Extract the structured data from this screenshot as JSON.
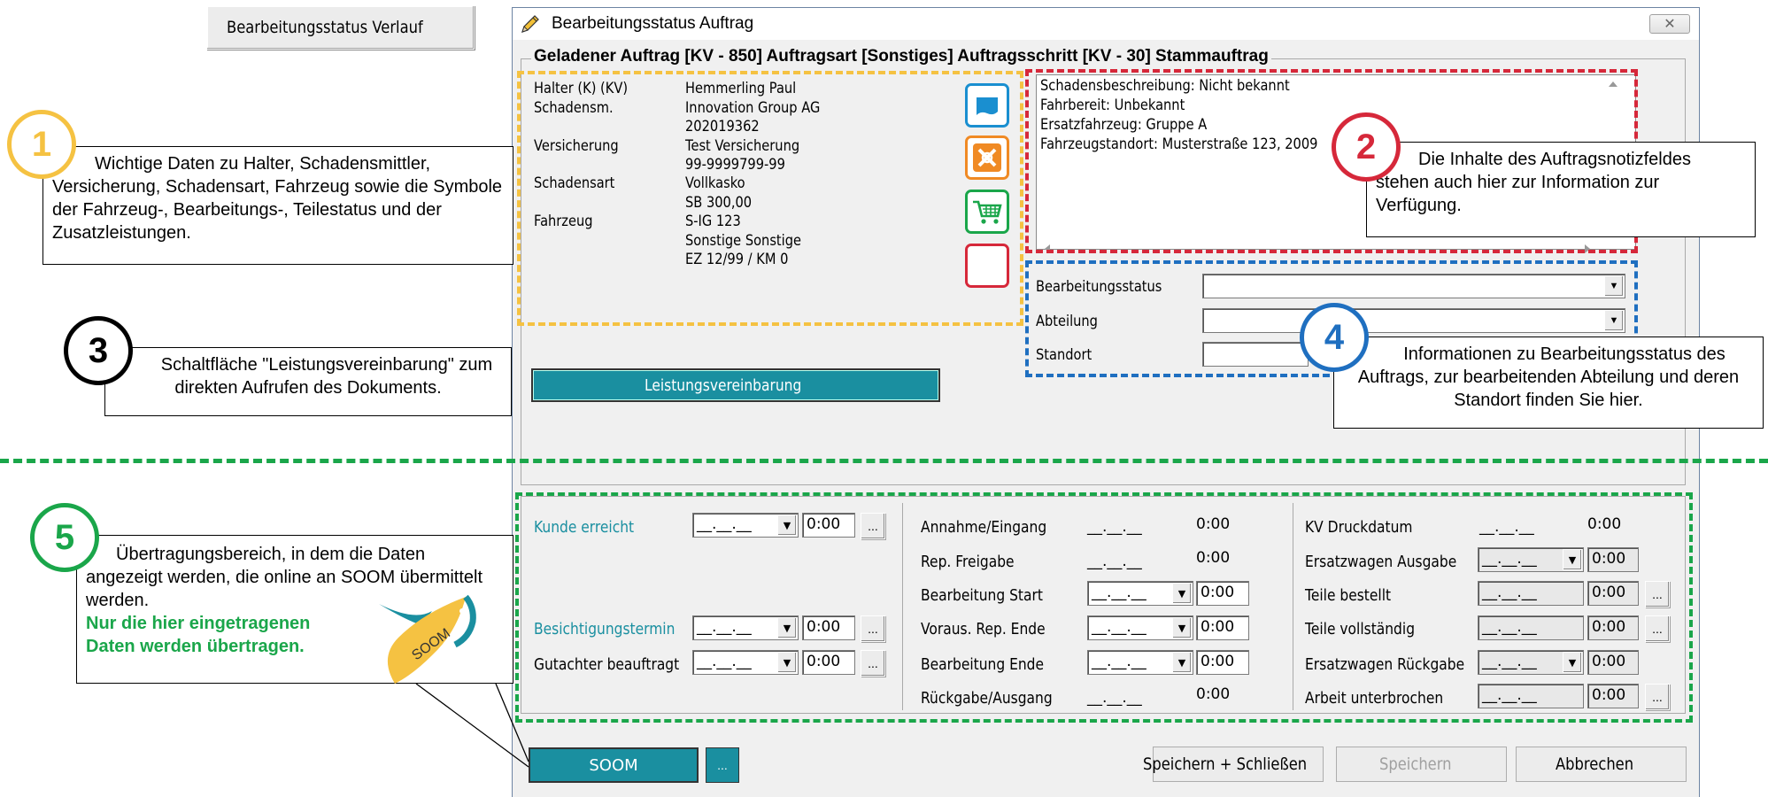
{
  "top_button": "Bearbeitungsstatus Verlauf",
  "window": {
    "title": "Bearbeitungsstatus Auftrag",
    "close": "✕"
  },
  "group_title": "Geladener Auftrag [KV - 850] Auftragsart [Sonstiges] Auftragsschritt [KV - 30] Stammauftrag",
  "info": {
    "labels": [
      "Halter (K) (KV)",
      "Schadensm.",
      "Versicherung",
      "Schadensart",
      "Fahrzeug"
    ],
    "values": [
      "Hemmerling Paul",
      "Innovation Group AG",
      "202019362",
      "Test Versicherung",
      "99-9999799-99",
      "Vollkasko",
      "SB 300,00",
      "S-IG 123",
      "Sonstige Sonstige",
      "EZ 12/99 / KM 0"
    ]
  },
  "icons": [
    "vehicle-status-icon",
    "processing-status-icon",
    "parts-status-icon",
    "additional-services-icon"
  ],
  "notes": [
    "Schadensbeschreibung: Nicht bekannt",
    "Fahrbereit: Unbekannt",
    "Ersatzfahrzeug: Gruppe A",
    "Fahrzeugstandort: Musterstraße 123, 2009"
  ],
  "status_fields": {
    "processing": "Bearbeitungsstatus",
    "department": "Abteilung",
    "location": "Standort"
  },
  "service_button": "Leistungsvereinbarung",
  "callouts": {
    "c1": {
      "num": "1",
      "text": "Wichtige Daten zu Halter, Schadensmittler, Versicherung, Schadensart, Fahrzeug sowie die Symbole der Fahrzeug-, Bearbeitungs-, Teilestatus und der Zusatzleistungen."
    },
    "c2": {
      "num": "2",
      "text": "Die Inhalte des Auftragsnotizfeldes stehen auch hier zur Information zur Verfügung."
    },
    "c3": {
      "num": "3",
      "text": "Schaltfläche \"Leistungsvereinbarung\" zum direkten Aufrufen des Dokuments."
    },
    "c4": {
      "num": "4",
      "text": "Informationen zu Bearbeitungsstatus des Auftrags, zur bearbeitenden Abteilung und deren Standort finden Sie hier."
    },
    "c5": {
      "num": "5",
      "text": "Übertragungsbereich, in dem die Daten angezeigt werden, die online  an SOOM übermittelt werden.",
      "bold1": "Nur die hier eingetragenen",
      "bold2": "Daten werden übertragen."
    }
  },
  "logo_text": "SOOM",
  "date_placeholder": "__.__.__",
  "time_default": "0:00",
  "ellipsis": "...",
  "col1": [
    "Kunde erreicht",
    "Besichtigungstermin",
    "Gutachter beauftragt"
  ],
  "col2": [
    "Annahme/Eingang",
    "Rep. Freigabe",
    "Bearbeitung Start",
    "Voraus. Rep. Ende",
    "Bearbeitung Ende",
    "Rückgabe/Ausgang"
  ],
  "col3": [
    "KV Druckdatum",
    "Ersatzwagen Ausgabe",
    "Teile bestellt",
    "Teile vollständig",
    "Ersatzwagen Rückgabe",
    "Arbeit unterbrochen"
  ],
  "buttons": {
    "soom": "SOOM",
    "save_close": "Speichern + Schließen",
    "save": "Speichern",
    "cancel": "Abbrechen"
  },
  "colors": {
    "yellow": "#f5c242",
    "red": "#d6283a",
    "blue": "#1f6fc0",
    "green": "#1aa64a",
    "teal": "#1a8fa0"
  }
}
